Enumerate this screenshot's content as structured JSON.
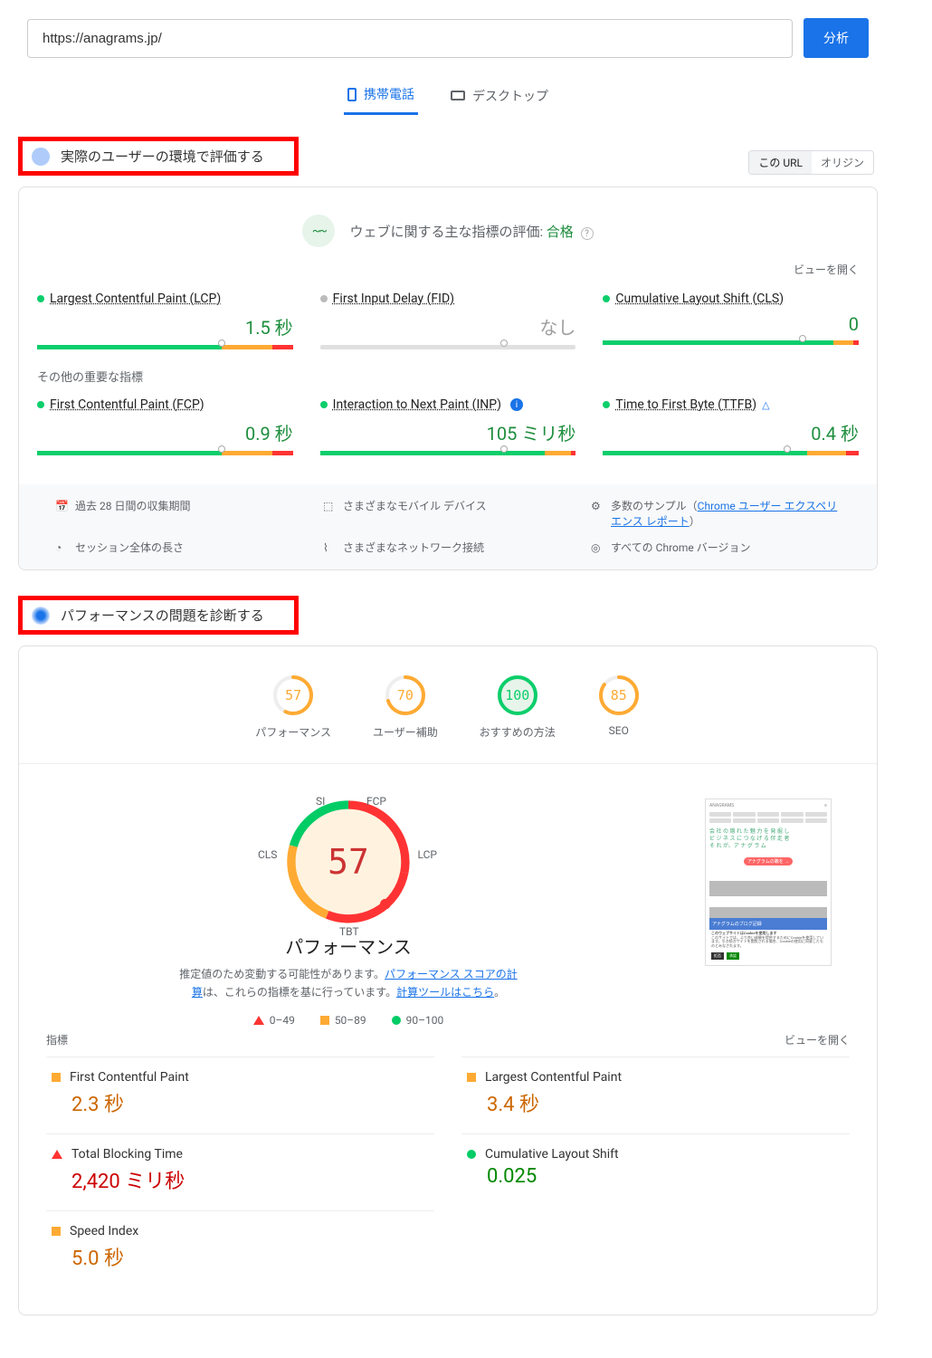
{
  "urlInput": {
    "value": "https://anagrams.jp/"
  },
  "analyzeButton": "分析",
  "tabs": {
    "mobile": "携帯電話",
    "desktop": "デスクトップ"
  },
  "sectionRealUser": "実際のユーザーの環境で評価する",
  "originToggle": {
    "thisUrl": "この URL",
    "origin": "オリジン"
  },
  "cwv": {
    "iconGlyph": "~~",
    "headingPrefix": "ウェブに関する主な指標の評価: ",
    "status": "合格"
  },
  "viewOpen": "ビューを開く",
  "metricsPrimary": [
    {
      "name": "Largest Contentful Paint (LCP)",
      "value": "1.5 秒",
      "status": "green",
      "bar": {
        "g": 72,
        "o": 20,
        "r": 8,
        "marker": 72
      }
    },
    {
      "name": "First Input Delay (FID)",
      "value": "なし",
      "status": "gray",
      "bar": null
    },
    {
      "name": "Cumulative Layout Shift (CLS)",
      "value": "0",
      "status": "green",
      "bar": {
        "g": 90,
        "o": 8,
        "r": 2,
        "marker": 78
      }
    }
  ],
  "otherMetricsLabel": "その他の重要な指標",
  "metricsSecondary": [
    {
      "name": "First Contentful Paint (FCP)",
      "value": "0.9 秒",
      "status": "green",
      "bar": {
        "g": 72,
        "o": 20,
        "r": 8,
        "marker": 72
      },
      "info": false
    },
    {
      "name": "Interaction to Next Paint (INP)",
      "value": "105 ミリ秒",
      "status": "green",
      "bar": {
        "g": 88,
        "o": 10,
        "r": 2,
        "marker": 72
      },
      "info": true
    },
    {
      "name": "Time to First Byte (TTFB)",
      "value": "0.4 秒",
      "status": "green",
      "bar": {
        "g": 80,
        "o": 15,
        "r": 5,
        "marker": 72
      },
      "info": false,
      "exp": true
    }
  ],
  "infoItems": {
    "period": "過去 28 日間の収集期間",
    "devices": "さまざまなモバイル デバイス",
    "samplesPrefix": "多数のサンプル（",
    "samplesLink": "Chrome ユーザー エクスペリエンス レポート",
    "samplesSuffix": "）",
    "session": "セッション全体の長さ",
    "networks": "さまざまなネットワーク接続",
    "versions": "すべての Chrome バージョン"
  },
  "sectionDiagnose": "パフォーマンスの問題を診断する",
  "scores": [
    {
      "label": "パフォーマンス",
      "value": 57,
      "color": "#fa3",
      "bg": "#fff"
    },
    {
      "label": "ユーザー補助",
      "value": 70,
      "color": "#fa3",
      "bg": "#fff"
    },
    {
      "label": "おすすめの方法",
      "value": 100,
      "color": "#0cce6b",
      "bg": "#e6f4ea"
    },
    {
      "label": "SEO",
      "value": 85,
      "color": "#fa3",
      "bg": "#fff"
    }
  ],
  "bigGauge": {
    "value": 57,
    "title": "パフォーマンス",
    "descPrefix": "推定値のため変動する可能性があります。",
    "descLink1": "パフォーマンス スコアの計算",
    "descMid": "は、これらの指標を基に行っています。",
    "descLink2": "計算ツールはこちら",
    "descSuffix": "。",
    "labels": {
      "si": "SI",
      "fcp": "FCP",
      "lcp": "LCP",
      "cls": "CLS",
      "tbt": "TBT"
    }
  },
  "legend": {
    "low": "0–49",
    "mid": "50–89",
    "high": "90–100"
  },
  "thumbnail": {
    "brand": "ANAGRAMS",
    "line1": "会 社 の 隠 れ た 魅 力 を 発 掘 し",
    "line2": "ビ ジ ネ ス に つ な げ る 伴 走 者",
    "line3": "そ れ が、ア ナ グ ラ ム",
    "button": "アナグラムの職を →",
    "banner": "アナグラムのブログ記録",
    "cookieTitle": "このウェブサイトはCookieを使用します",
    "btn1": "拒否",
    "btn2": "承認"
  },
  "metricsTableHead": {
    "left": "指標",
    "right": "ビューを開く"
  },
  "metricCards": [
    {
      "name": "First Contentful Paint",
      "value": "2.3 秒",
      "status": "orange",
      "shape": "sq"
    },
    {
      "name": "Largest Contentful Paint",
      "value": "3.4 秒",
      "status": "orange",
      "shape": "sq"
    },
    {
      "name": "Total Blocking Time",
      "value": "2,420 ミリ秒",
      "status": "red",
      "shape": "tri"
    },
    {
      "name": "Cumulative Layout Shift",
      "value": "0.025",
      "status": "green",
      "shape": "ci"
    },
    {
      "name": "Speed Index",
      "value": "5.0 秒",
      "status": "orange",
      "shape": "sq"
    }
  ]
}
